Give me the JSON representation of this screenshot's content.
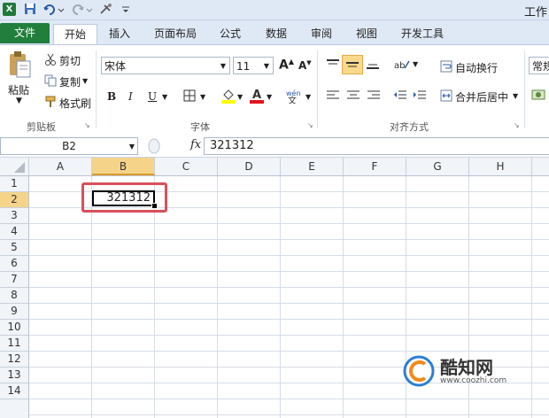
{
  "window": {
    "title": "工作"
  },
  "quick_access": {
    "icons": [
      "excel-icon",
      "save-icon",
      "undo-icon",
      "redo-icon",
      "customize-icon"
    ]
  },
  "tabs": [
    "文件",
    "开始",
    "插入",
    "页面布局",
    "公式",
    "数据",
    "审阅",
    "视图",
    "开发工具"
  ],
  "ribbon": {
    "clipboard": {
      "paste": "粘贴",
      "cut": "剪切",
      "copy": "复制",
      "format_painter": "格式刷",
      "group_label": "剪贴板"
    },
    "font": {
      "name": "宋体",
      "size": "11",
      "bold": "B",
      "italic": "I",
      "underline": "U",
      "group_label": "字体"
    },
    "alignment": {
      "wrap_text": "自动换行",
      "merge_center": "合并后居中",
      "group_label": "对齐方式"
    },
    "number": {
      "format": "常规"
    }
  },
  "formula_bar": {
    "name_box": "B2",
    "fx": "fx",
    "value": "321312"
  },
  "columns": [
    "A",
    "B",
    "C",
    "D",
    "E",
    "F",
    "G",
    "H"
  ],
  "rows": [
    "1",
    "2",
    "3",
    "4",
    "5",
    "6",
    "7",
    "8",
    "9",
    "10",
    "11",
    "12",
    "13",
    "14"
  ],
  "selected_cell": {
    "value": "321312"
  },
  "watermark": {
    "brand": "酷知网",
    "url": "www.coozhi.com"
  },
  "colors": {
    "file_tab": "#217e3b",
    "highlight": "#d9505a",
    "selected_header": "#f5d48a"
  }
}
